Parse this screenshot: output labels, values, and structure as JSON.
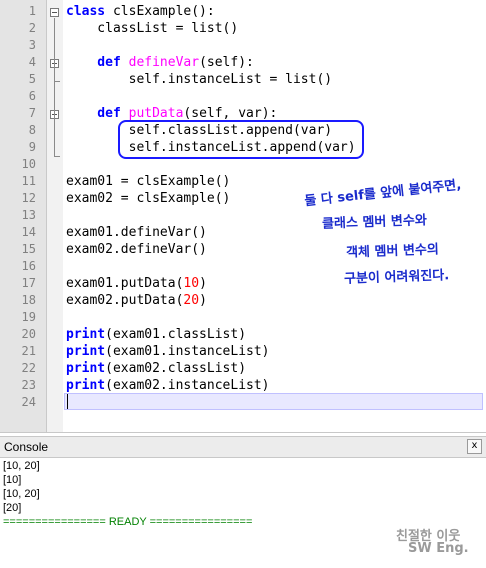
{
  "editor": {
    "line_numbers": [
      "1",
      "2",
      "3",
      "4",
      "5",
      "6",
      "7",
      "8",
      "9",
      "10",
      "11",
      "12",
      "13",
      "14",
      "15",
      "16",
      "17",
      "18",
      "19",
      "20",
      "21",
      "22",
      "23",
      "24"
    ],
    "lines": [
      [
        {
          "t": "class ",
          "c": "kw"
        },
        {
          "t": "clsExample():",
          "c": "pl"
        }
      ],
      [
        {
          "t": "    classList = list()",
          "c": "pl"
        }
      ],
      [],
      [
        {
          "t": "    def ",
          "c": "kw"
        },
        {
          "t": "defineVar",
          "c": "fn"
        },
        {
          "t": "(self):",
          "c": "pl"
        }
      ],
      [
        {
          "t": "        self.instanceList = list()",
          "c": "pl"
        }
      ],
      [],
      [
        {
          "t": "    def ",
          "c": "kw"
        },
        {
          "t": "putData",
          "c": "fn"
        },
        {
          "t": "(self, var):",
          "c": "pl"
        }
      ],
      [
        {
          "t": "        self.classList.append(var)",
          "c": "pl"
        }
      ],
      [
        {
          "t": "        self.instanceList.append(var)",
          "c": "pl"
        }
      ],
      [],
      [
        {
          "t": "exam01 = clsExample()",
          "c": "pl"
        }
      ],
      [
        {
          "t": "exam02 = clsExample()",
          "c": "pl"
        }
      ],
      [],
      [
        {
          "t": "exam01.defineVar()",
          "c": "pl"
        }
      ],
      [
        {
          "t": "exam02.defineVar()",
          "c": "pl"
        }
      ],
      [],
      [
        {
          "t": "exam01.putData(",
          "c": "pl"
        },
        {
          "t": "10",
          "c": "num"
        },
        {
          "t": ")",
          "c": "pl"
        }
      ],
      [
        {
          "t": "exam02.putData(",
          "c": "pl"
        },
        {
          "t": "20",
          "c": "num"
        },
        {
          "t": ")",
          "c": "pl"
        }
      ],
      [],
      [
        {
          "t": "print",
          "c": "kw"
        },
        {
          "t": "(exam01.classList)",
          "c": "pl"
        }
      ],
      [
        {
          "t": "print",
          "c": "kw"
        },
        {
          "t": "(exam01.instanceList)",
          "c": "pl"
        }
      ],
      [
        {
          "t": "print",
          "c": "kw"
        },
        {
          "t": "(exam02.classList)",
          "c": "pl"
        }
      ],
      [
        {
          "t": "print",
          "c": "kw"
        },
        {
          "t": "(exam02.instanceList)",
          "c": "pl"
        }
      ],
      []
    ]
  },
  "annotation": {
    "lines": [
      "둘 다 self를 앞에 붙여주면,",
      "클래스 멤버 변수와",
      "객체 멤버 변수의",
      "구분이 어려워진다."
    ]
  },
  "console": {
    "title": "Console",
    "close_label": "x",
    "output": [
      "[10, 20]",
      "[10]",
      "[10, 20]",
      "[20]"
    ],
    "ready_line": "================ READY ================"
  },
  "watermark": {
    "line1": "친절한 이웃",
    "line2": "SW Eng."
  },
  "colors": {
    "keyword": "#0000ff",
    "function_name": "#ff00ff",
    "number": "#ff0000",
    "annotation": "#1a2bcc",
    "ready": "#008000"
  }
}
